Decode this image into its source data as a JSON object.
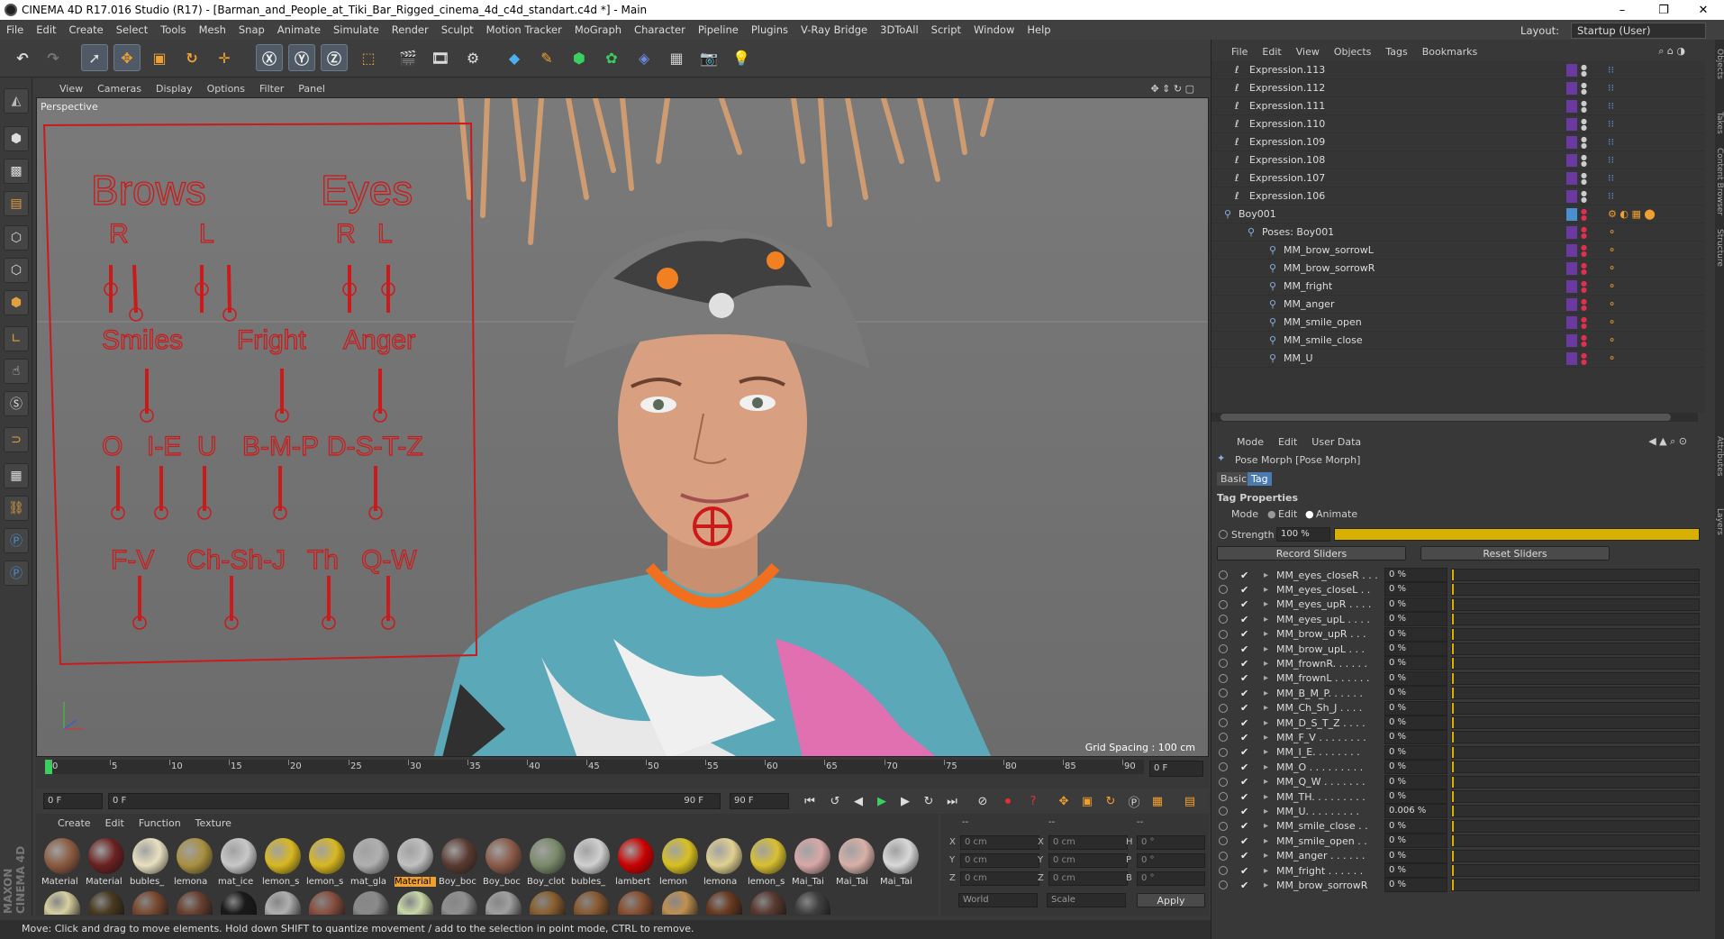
{
  "window": {
    "title": "CINEMA 4D R17.016 Studio (R17) - [Barman_and_People_at_Tiki_Bar_Rigged_cinema_4d_c4d_standart.c4d *] - Main",
    "minimize": "–",
    "maximize": "❐",
    "close": "✕"
  },
  "menubar": [
    "File",
    "Edit",
    "Create",
    "Select",
    "Tools",
    "Mesh",
    "Snap",
    "Animate",
    "Simulate",
    "Render",
    "Sculpt",
    "Motion Tracker",
    "MoGraph",
    "Character",
    "Pipeline",
    "Plugins",
    "V-Ray Bridge",
    "3DToAll",
    "Script",
    "Window",
    "Help"
  ],
  "layout": {
    "label": "Layout:",
    "value": "Startup (User)"
  },
  "viewport": {
    "menu": [
      "View",
      "Cameras",
      "Display",
      "Options",
      "Filter",
      "Panel"
    ],
    "label": "Perspective",
    "grid_spacing": "Grid Spacing : 100 cm",
    "face_rig": {
      "heading_brows": "Brows",
      "heading_eyes": "Eyes",
      "brow_r": "R",
      "brow_l": "L",
      "eye_r": "R",
      "eye_l": "L",
      "smiles": "Smiles",
      "fright": "Fright",
      "anger": "Anger",
      "o": "O",
      "ie": "I-E",
      "u": "U",
      "bmp": "B-M-P",
      "dstz": "D-S-T-Z",
      "fv": "F-V",
      "chshj": "Ch-Sh-J",
      "th": "Th",
      "qw": "Q-W"
    }
  },
  "timeline": {
    "ticks": [
      "0",
      "5",
      "10",
      "15",
      "20",
      "25",
      "30",
      "35",
      "40",
      "45",
      "50",
      "55",
      "60",
      "65",
      "70",
      "75",
      "80",
      "85",
      "90"
    ],
    "current_frame": "0 F"
  },
  "playback": {
    "start": "0 F",
    "range_start": "0 F",
    "range_end": "90 F",
    "end": "90 F"
  },
  "materials": {
    "menu": [
      "Create",
      "Edit",
      "Function",
      "Texture"
    ],
    "row1": [
      {
        "label": "Material",
        "color": "#8a5a40"
      },
      {
        "label": "Material",
        "color": "#6a2020"
      },
      {
        "label": "bubles_",
        "color": "#e8e0c0"
      },
      {
        "label": "lemona",
        "color": "#a89040"
      },
      {
        "label": "mat_ice",
        "color": "#c8c8c8"
      },
      {
        "label": "lemon_s",
        "color": "#d8b820"
      },
      {
        "label": "lemon_s",
        "color": "#d8b820"
      },
      {
        "label": "mat_gla",
        "color": "#b0b0b0"
      },
      {
        "label": "Material",
        "color": "#c0c0c0"
      },
      {
        "label": "Boy_boc",
        "color": "#5a3a30"
      },
      {
        "label": "Boy_boc",
        "color": "#8a5a48"
      },
      {
        "label": "Boy_clot",
        "color": "#7a8a6a"
      },
      {
        "label": "bubles_",
        "color": "#d0d0d0"
      },
      {
        "label": "lambert",
        "color": "#cc0000"
      },
      {
        "label": "lemon",
        "color": "#d8c020"
      },
      {
        "label": "lemona",
        "color": "#e0d090"
      },
      {
        "label": "lemon_s",
        "color": "#d8c030"
      },
      {
        "label": "Mai_Tai",
        "color": "#d8a8a8"
      },
      {
        "label": "Mai_Tai",
        "color": "#d8b0a8"
      },
      {
        "label": "Mai_Tai",
        "color": "#d8d8d8"
      }
    ],
    "row2_colors": [
      "#d8d0a0",
      "#4a3a20",
      "#7a4a30",
      "#6a4030",
      "#1a1a1a",
      "#b0b0b0",
      "#8a5040",
      "#8a8a8a",
      "#c8d8a8",
      "#909090",
      "#a0a0a0",
      "#8a6030",
      "#8a5a30",
      "#8a5030",
      "#c09050",
      "#6a3a20",
      "#5a3a30",
      "#404040"
    ]
  },
  "coords": {
    "x_label": "X",
    "y_label": "Y",
    "z_label": "Z",
    "px": "0 cm",
    "py": "0 cm",
    "pz": "0 cm",
    "sx": "0 cm",
    "sy": "0 cm",
    "sz": "0 cm",
    "h_label": "H",
    "p_label": "P",
    "b_label": "B",
    "rh": "0 °",
    "rp": "0 °",
    "rb": "0 °",
    "world": "World",
    "scale": "Scale",
    "apply": "Apply",
    "dash": "--"
  },
  "status": "Move: Click and drag to move elements. Hold down SHIFT to quantize movement / add to the selection in point mode, CTRL to remove.",
  "objects": {
    "menu": [
      "File",
      "Edit",
      "View",
      "Objects",
      "Tags",
      "Bookmarks"
    ],
    "rows": [
      {
        "name": "Expression.113",
        "indent": 42
      },
      {
        "name": "Expression.112",
        "indent": 42
      },
      {
        "name": "Expression.111",
        "indent": 42
      },
      {
        "name": "Expression.110",
        "indent": 42
      },
      {
        "name": "Expression.109",
        "indent": 42
      },
      {
        "name": "Expression.108",
        "indent": 42
      },
      {
        "name": "Expression.107",
        "indent": 42
      },
      {
        "name": "Expression.106",
        "indent": 42
      },
      {
        "name": "Boy001",
        "indent": 30
      },
      {
        "name": "Poses: Boy001",
        "indent": 56
      },
      {
        "name": "MM_brow_sorrowL",
        "indent": 80
      },
      {
        "name": "MM_brow_sorrowR",
        "indent": 80
      },
      {
        "name": "MM_fright",
        "indent": 80
      },
      {
        "name": "MM_anger",
        "indent": 80
      },
      {
        "name": "MM_smile_open",
        "indent": 80
      },
      {
        "name": "MM_smile_close",
        "indent": 80
      },
      {
        "name": "MM_U",
        "indent": 80
      }
    ]
  },
  "attributes": {
    "menu": [
      "Mode",
      "Edit",
      "User Data"
    ],
    "object_title": "Pose Morph [Pose Morph]",
    "tabs": [
      "Basic",
      "Tag"
    ],
    "section": "Tag Properties",
    "mode_label": "Mode",
    "mode_edit": "Edit",
    "mode_animate": "Animate",
    "strength_label": "Strength",
    "strength_value": "100 %",
    "strength_level": 1.0,
    "record_button": "Record Sliders",
    "reset_button": "Reset Sliders",
    "sliders": [
      {
        "name": "MM_eyes_closeR . . .",
        "value": "0 %"
      },
      {
        "name": "MM_eyes_closeL . .",
        "value": "0 %"
      },
      {
        "name": "MM_eyes_upR . . . .",
        "value": "0 %"
      },
      {
        "name": "MM_eyes_upL . . . .",
        "value": "0 %"
      },
      {
        "name": "MM_brow_upR . . .",
        "value": "0 %"
      },
      {
        "name": "MM_brow_upL . . .",
        "value": "0 %"
      },
      {
        "name": "MM_frownR. . . . . .",
        "value": "0 %"
      },
      {
        "name": "MM_frownL . . . . . .",
        "value": "0 %"
      },
      {
        "name": "MM_B_M_P. . . . . .",
        "value": "0 %"
      },
      {
        "name": "MM_Ch_Sh_J . . . .",
        "value": "0 %"
      },
      {
        "name": "MM_D_S_T_Z . . . .",
        "value": "0 %"
      },
      {
        "name": "MM_F_V . . . . . . . .",
        "value": "0 %"
      },
      {
        "name": "MM_I_E. . . . . . . .",
        "value": "0 %"
      },
      {
        "name": "MM_O . . . . . . . . .",
        "value": "0 %"
      },
      {
        "name": "MM_Q_W . . . . . . .",
        "value": "0 %"
      },
      {
        "name": "MM_TH. . . . . . . . .",
        "value": "0 %"
      },
      {
        "name": "MM_U. . . . . . . . .",
        "value": "0.006 %"
      },
      {
        "name": "MM_smile_close . .",
        "value": "0 %"
      },
      {
        "name": "MM_smile_open . .",
        "value": "0 %"
      },
      {
        "name": "MM_anger . . . . . .",
        "value": "0 %"
      },
      {
        "name": "MM_fright . . . . . .",
        "value": "0 %"
      },
      {
        "name": "MM_brow_sorrowR",
        "value": "0 %"
      }
    ]
  },
  "side_tabs": [
    "Objects",
    "Takes",
    "Content Browser",
    "Structure",
    "Attributes",
    "Layers"
  ],
  "colors": {
    "accent": "#d8b000",
    "rig_red": "#cc1a1a",
    "selection": "#4f5a66"
  }
}
